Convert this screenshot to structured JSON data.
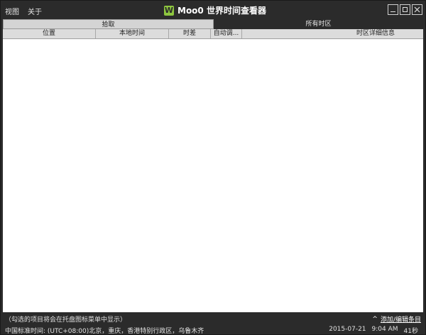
{
  "menu": {
    "view": "视图",
    "about": "关于"
  },
  "title": {
    "logo_letter": "W",
    "text": "Moo0 世界时间查看器"
  },
  "tabs": [
    {
      "label": "拾取"
    },
    {
      "label": "所有时区"
    }
  ],
  "columns": [
    {
      "label": "位置"
    },
    {
      "label": "本地时间"
    },
    {
      "label": "时差"
    },
    {
      "label": "自动调..."
    },
    {
      "label": "时区详细信息"
    }
  ],
  "rows": [],
  "footer": {
    "hint": "（勾选的项目将会在托盘图标菜单中显示）",
    "caret": "^",
    "add_edit": "添加/编辑条目"
  },
  "status": {
    "timezone": "中国标准时间: (UTC+08:00)北京，重庆，香港特别行政区，乌鲁木齐",
    "date": "2015-07-21",
    "time": "9:04 AM",
    "seconds": "41秒"
  },
  "colors": {
    "background": "#2b2b2b",
    "logo": "#8ec63f",
    "tab_active": "#d4d4d4",
    "list": "#ffffff"
  }
}
